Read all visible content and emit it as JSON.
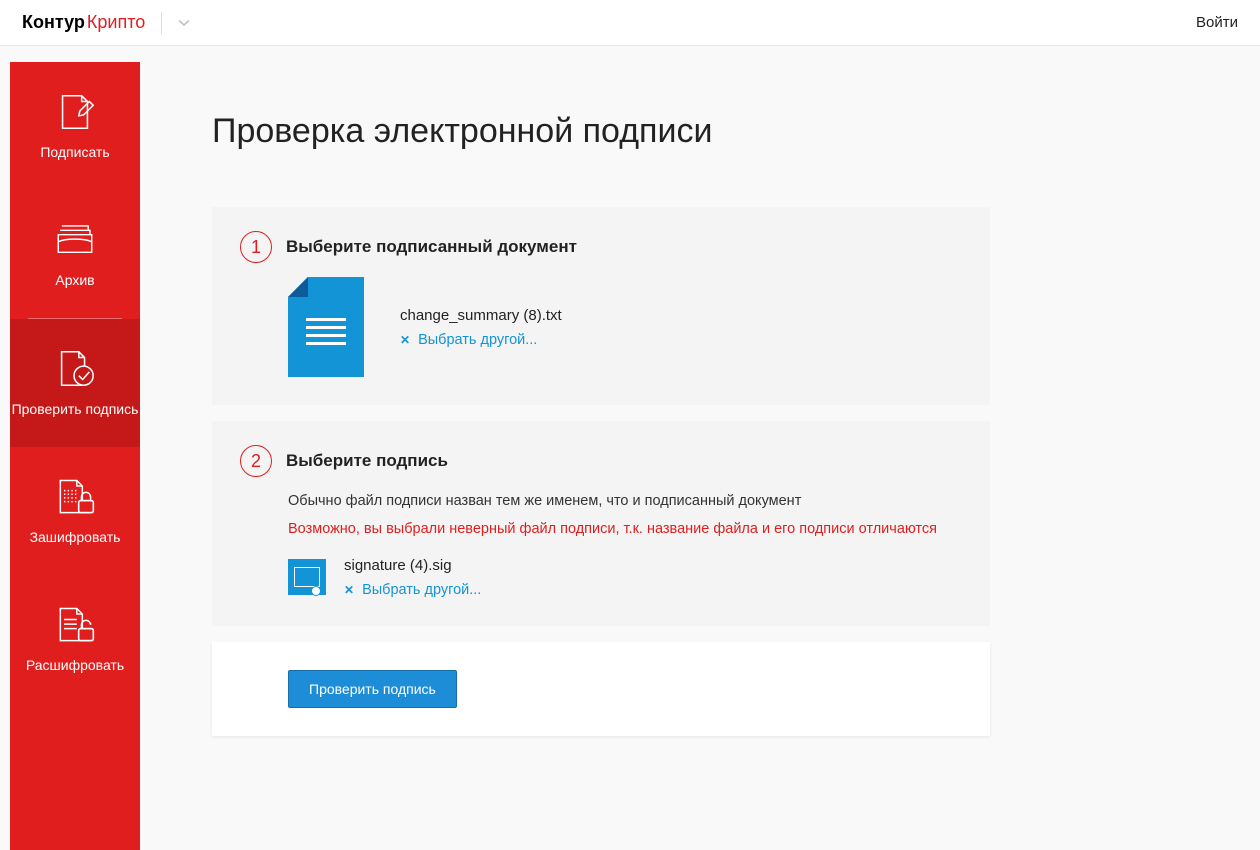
{
  "header": {
    "logo_part1": "Контур",
    "logo_part2": "Крипто",
    "login": "Войти"
  },
  "sidebar": {
    "items": [
      {
        "label": "Подписать"
      },
      {
        "label": "Архив"
      },
      {
        "label": "Проверить подпись"
      },
      {
        "label": "Зашифровать"
      },
      {
        "label": "Расшифровать"
      }
    ]
  },
  "main": {
    "title": "Проверка электронной подписи",
    "step1": {
      "num": "1",
      "title": "Выберите подписанный документ",
      "filename": "change_summary (8).txt",
      "choose_other": "Выбрать другой..."
    },
    "step2": {
      "num": "2",
      "title": "Выберите подпись",
      "hint": "Обычно файл подписи назван тем же именем, что и подписанный документ",
      "warn": "Возможно, вы выбрали неверный файл подписи, т.к. название файла и его подписи отличаются",
      "filename": "signature (4).sig",
      "choose_other": "Выбрать другой..."
    },
    "submit": "Проверить подпись"
  }
}
